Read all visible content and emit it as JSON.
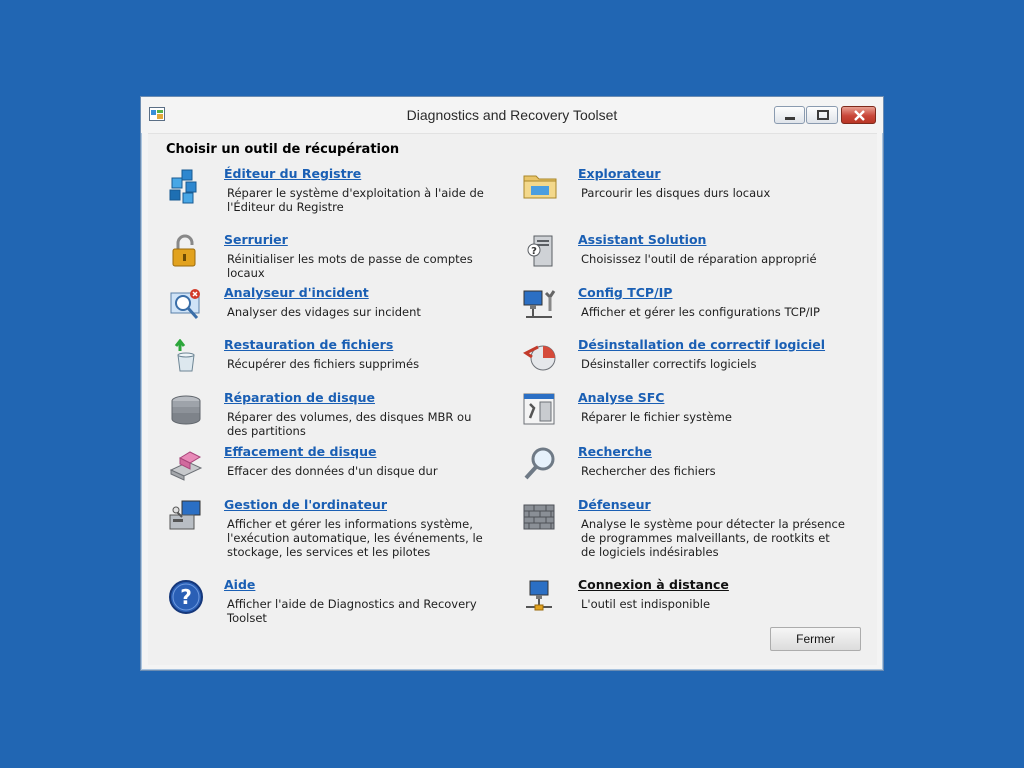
{
  "window": {
    "title": "Diagnostics and Recovery Toolset"
  },
  "heading": "Choisir un outil de récupération",
  "tools_left": [
    {
      "icon": "registry-cubes-icon",
      "name": "Éditeur du Registre",
      "desc": "Réparer le système d'exploitation à l'aide de l'Éditeur du Registre"
    },
    {
      "icon": "padlock-icon",
      "name": "Serrurier",
      "desc": "Réinitialiser les mots de passe de comptes locaux"
    },
    {
      "icon": "crash-analyzer-icon",
      "name": "Analyseur d'incident",
      "desc": "Analyser des vidages sur incident"
    },
    {
      "icon": "recycle-bin-restore-icon",
      "name": "Restauration de fichiers",
      "desc": "Récupérer des fichiers supprimés"
    },
    {
      "icon": "disk-stack-icon",
      "name": "Réparation de disque",
      "desc": "Réparer des volumes, des disques MBR ou des partitions"
    },
    {
      "icon": "eraser-icon",
      "name": "Effacement de disque",
      "desc": "Effacer des données d'un disque dur"
    },
    {
      "icon": "computer-management-icon",
      "name": "Gestion de l'ordinateur",
      "desc": "Afficher et gérer les informations système, l'exécution automatique, les événements, le stockage, les services et les pilotes"
    },
    {
      "icon": "help-question-icon",
      "name": "Aide",
      "desc": "Afficher l'aide de Diagnostics and Recovery Toolset"
    }
  ],
  "tools_right": [
    {
      "icon": "folder-explorer-icon",
      "name": "Explorateur",
      "desc": "Parcourir les disques durs locaux"
    },
    {
      "icon": "solution-wizard-icon",
      "name": "Assistant Solution",
      "desc": "Choisissez l'outil de réparation approprié"
    },
    {
      "icon": "network-config-icon",
      "name": "Config TCP/IP",
      "desc": "Afficher et gérer les configurations TCP/IP"
    },
    {
      "icon": "hotfix-uninstall-icon",
      "name": "Désinstallation de correctif logiciel",
      "desc": "Désinstaller correctifs logiciels"
    },
    {
      "icon": "sfc-icon",
      "name": "Analyse SFC",
      "desc": "Réparer le fichier système"
    },
    {
      "icon": "magnifier-icon",
      "name": "Recherche",
      "desc": "Rechercher des fichiers"
    },
    {
      "icon": "firewall-wall-icon",
      "name": "Défenseur",
      "desc": "Analyse le système pour détecter la présence de programmes malveillants, de rootkits et de logiciels indésirables"
    },
    {
      "icon": "remote-connection-icon",
      "name": "Connexion à distance",
      "desc": "L'outil est indisponible"
    }
  ],
  "close_button_label": "Fermer",
  "colors": {
    "desktop": "#2166b3",
    "link": "#1a5fb4"
  }
}
